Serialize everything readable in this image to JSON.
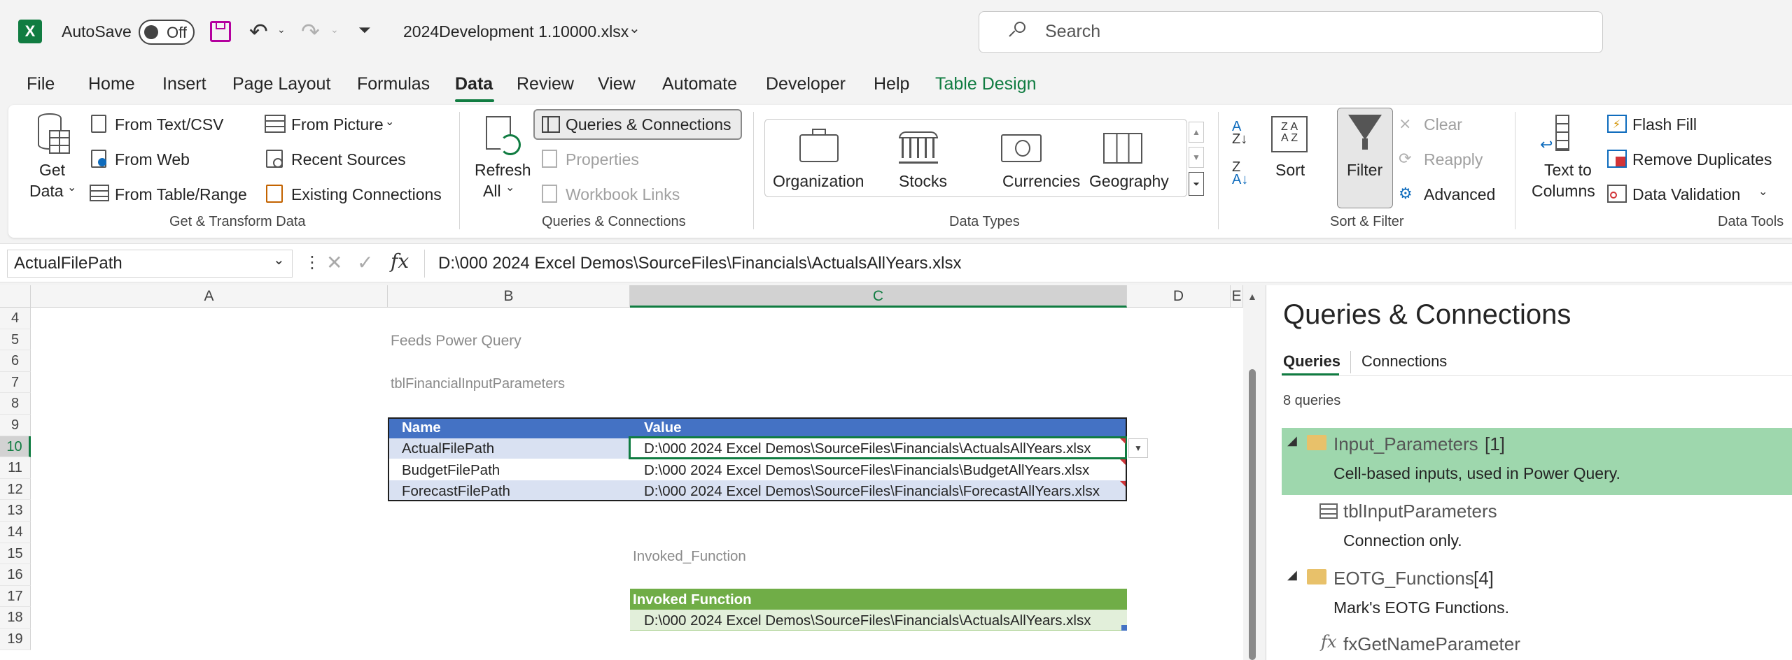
{
  "titlebar": {
    "autosave_label": "AutoSave",
    "autosave_state": "Off",
    "filename": "2024Development 1.10000.xlsx",
    "search_placeholder": "Search"
  },
  "menu": [
    "File",
    "Home",
    "Insert",
    "Page Layout",
    "Formulas",
    "Data",
    "Review",
    "View",
    "Automate",
    "Developer",
    "Help",
    "Table Design"
  ],
  "menu_active": "Data",
  "ribbon": {
    "get_data": [
      "Get",
      "Data"
    ],
    "from_text_csv": "From Text/CSV",
    "from_web": "From Web",
    "from_table_range": "From Table/Range",
    "from_picture": "From Picture",
    "recent_sources": "Recent Sources",
    "existing_connections": "Existing Connections",
    "group_get_transform": "Get & Transform Data",
    "refresh_all": [
      "Refresh",
      "All"
    ],
    "queries_connections": "Queries & Connections",
    "properties": "Properties",
    "workbook_links": "Workbook Links",
    "group_queries": "Queries & Connections",
    "data_types": [
      "Organization",
      "Stocks",
      "Currencies",
      "Geography"
    ],
    "group_data_types": "Data Types",
    "sort": "Sort",
    "filter": "Filter",
    "clear": "Clear",
    "reapply": "Reapply",
    "advanced": "Advanced",
    "group_sort_filter": "Sort & Filter",
    "text_to_columns": [
      "Text to",
      "Columns"
    ],
    "flash_fill": "Flash Fill",
    "remove_duplicates": "Remove Duplicates",
    "data_validation": "Data Validation",
    "group_data_tools": "Data Tools"
  },
  "formula_bar": {
    "name_box": "ActualFilePath",
    "formula": "D:\\000 2024 Excel Demos\\SourceFiles\\Financials\\ActualsAllYears.xlsx"
  },
  "grid": {
    "columns": [
      "A",
      "B",
      "C",
      "D",
      "E"
    ],
    "rows": [
      "4",
      "5",
      "6",
      "7",
      "8",
      "9",
      "10",
      "11",
      "12",
      "13",
      "14",
      "15",
      "16",
      "17",
      "18",
      "19"
    ],
    "feeds_label": "Feeds Power Query",
    "table_name": "tblFinancialInputParameters",
    "table_headers": [
      "Name",
      "Value"
    ],
    "table_rows": [
      [
        "ActualFilePath",
        "D:\\000 2024 Excel Demos\\SourceFiles\\Financials\\ActualsAllYears.xlsx"
      ],
      [
        "BudgetFilePath",
        "D:\\000 2024 Excel Demos\\SourceFiles\\Financials\\BudgetAllYears.xlsx"
      ],
      [
        "ForecastFilePath",
        "D:\\000 2024 Excel Demos\\SourceFiles\\Financials\\ForecastAllYears.xlsx"
      ]
    ],
    "invoked_label": "Invoked_Function",
    "invoked_header": "Invoked Function",
    "invoked_value": "D:\\000 2024 Excel Demos\\SourceFiles\\Financials\\ActualsAllYears.xlsx"
  },
  "pane": {
    "title": "Queries & Connections",
    "tab_queries": "Queries",
    "tab_connections": "Connections",
    "count": "8 queries",
    "groups": [
      {
        "name": "Input_Parameters",
        "count": "[1]",
        "desc": "Cell-based inputs, used in Power Query."
      },
      {
        "name": "EOTG_Functions",
        "count": "[4]",
        "desc": "Mark's EOTG Functions."
      }
    ],
    "item_table": "tblInputParameters",
    "item_table_desc": "Connection only.",
    "item_fx": "fxGetNameParameter"
  },
  "colors": {
    "excel_green": "#107c41",
    "table_header_blue": "#4472c4",
    "table_band_blue": "#d9e1f2",
    "invoked_header_green": "#70ad47",
    "invoked_band_green": "#e2efda",
    "pane_highlight": "#9ed7ad"
  }
}
